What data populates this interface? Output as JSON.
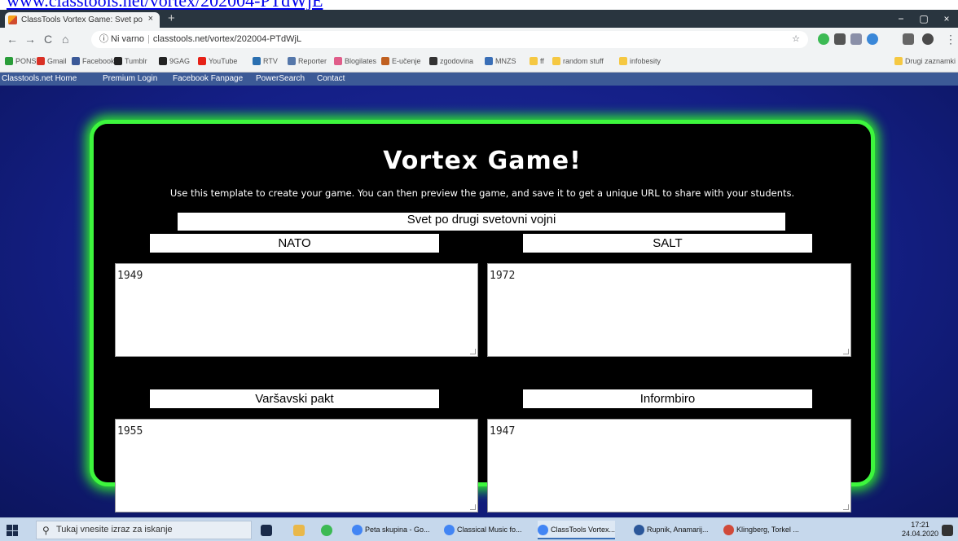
{
  "top_link": "www.classtools.net/vortex/202004-PTdWjE",
  "browser": {
    "tab_title": "ClassTools Vortex Game: Svet po",
    "tab_close": "×",
    "new_tab": "+",
    "win_min": "−",
    "win_max": "▢",
    "win_close": "×",
    "back": "←",
    "forward": "→",
    "reload": "C",
    "home": "⌂",
    "security": "ⓘ Ni varno",
    "url": "classtools.net/vortex/202004-PTdWjL",
    "star": "☆"
  },
  "bookmarks": [
    {
      "label": "PONS",
      "color": "#2a9d3a"
    },
    {
      "label": "Gmail",
      "color": "#d93025"
    },
    {
      "label": "Facebook",
      "color": "#3b5998"
    },
    {
      "label": "Tumblr",
      "color": "#222"
    },
    {
      "label": "9GAG",
      "color": "#222"
    },
    {
      "label": "YouTube",
      "color": "#e62117"
    },
    {
      "label": "RTV",
      "color": "#2a6fb0"
    },
    {
      "label": "Reporter",
      "color": "#5577aa"
    },
    {
      "label": "Blogilates",
      "color": "#e05d8a"
    },
    {
      "label": "E-učenje",
      "color": "#c06020"
    },
    {
      "label": "zgodovina",
      "color": "#333"
    },
    {
      "label": "MNZS",
      "color": "#3a6fb7"
    },
    {
      "label": "ff",
      "color": "#f5c842"
    },
    {
      "label": "random stuff",
      "color": "#f5c842"
    },
    {
      "label": "infobesity",
      "color": "#f5c842"
    }
  ],
  "bookmarks_other": "Drugi zaznamki",
  "site_nav": [
    "Classtools.net Home",
    "Premium Login",
    "Facebook Fanpage",
    "PowerSearch",
    "Contact"
  ],
  "game": {
    "title": "Vortex Game!",
    "subtitle": "Use this template to create your game. You can then preview the game, and save it to get a unique URL to share with your students.",
    "name": "Svet po drugi svetovni vojni",
    "categories": [
      {
        "label": "NATO",
        "text": "1949"
      },
      {
        "label": "SALT",
        "text": "1972"
      },
      {
        "label": "Varšavski pakt",
        "text": "1955"
      },
      {
        "label": "Informbiro",
        "text": "1947"
      }
    ]
  },
  "taskbar": {
    "search_placeholder": "Tukaj vnesite izraz za iskanje",
    "apps": [
      {
        "label": "Peta skupina - Go...",
        "color": "#4285f4"
      },
      {
        "label": "Classical Music fo...",
        "color": "#4285f4"
      },
      {
        "label": "ClassTools Vortex...",
        "color": "#4285f4"
      },
      {
        "label": "Rupnik, Anamarij...",
        "color": "#2b579a"
      },
      {
        "label": "Klingberg, Torkel ...",
        "color": "#d04a3a"
      }
    ],
    "time": "17:21",
    "date": "24.04.2020"
  }
}
